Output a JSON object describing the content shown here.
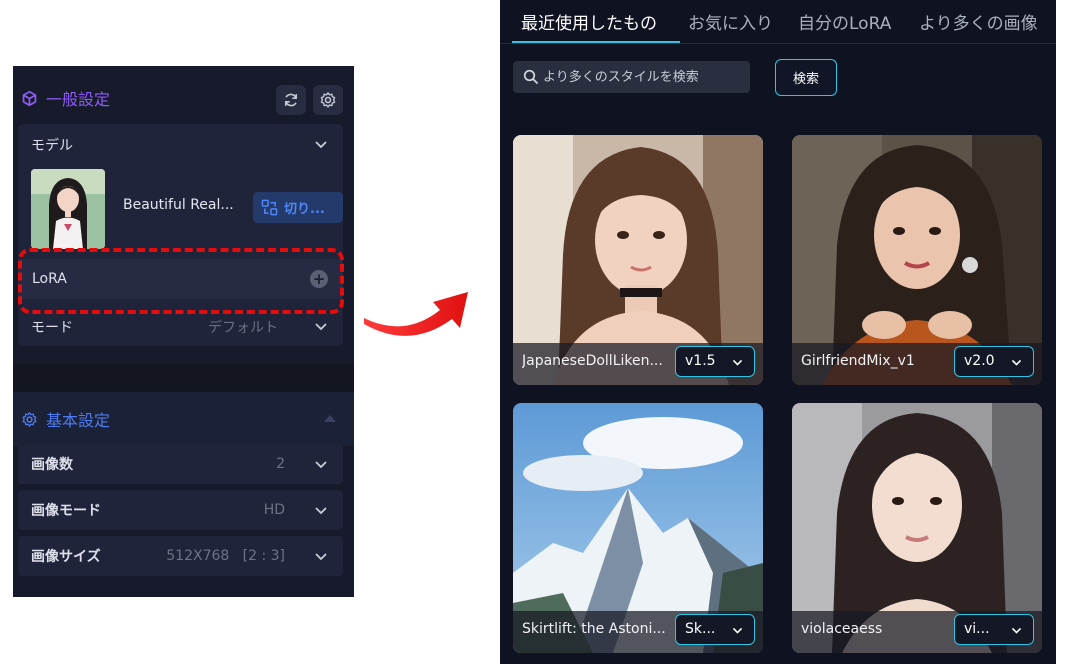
{
  "left_panel": {
    "general_title": "一般設定",
    "model_label": "モデル",
    "model_name": "Beautiful Real...",
    "switch_label": "切り...",
    "lora_label": "LoRA",
    "mode_label": "モード",
    "mode_value": "デフォルト",
    "basic_title": "基本設定",
    "settings": [
      {
        "label": "画像数",
        "value": "2"
      },
      {
        "label": "画像モード",
        "value": "HD"
      },
      {
        "label": "画像サイズ",
        "value": "512X768   [2 : 3]"
      }
    ]
  },
  "right_panel": {
    "tabs": [
      "最近使用したもの",
      "お気に入り",
      "自分のLoRA",
      "より多くの画像"
    ],
    "search_placeholder": "より多くのスタイルを検索",
    "search_button": "検索",
    "cards": [
      {
        "name": "JapaneseDollLiken...",
        "version": "v1.5"
      },
      {
        "name": "GirlfriendMix_v1",
        "version": "v2.0"
      },
      {
        "name": "Skirtlift: the Astoni...",
        "version": "Sk..."
      },
      {
        "name": "violaceaess",
        "version": "vi..."
      }
    ]
  },
  "colors": {
    "accent_cyan": "#2ec4e6",
    "general_purple": "#8b5cf6",
    "basic_blue": "#4f7cf0",
    "highlight_red": "#e40c0c"
  }
}
